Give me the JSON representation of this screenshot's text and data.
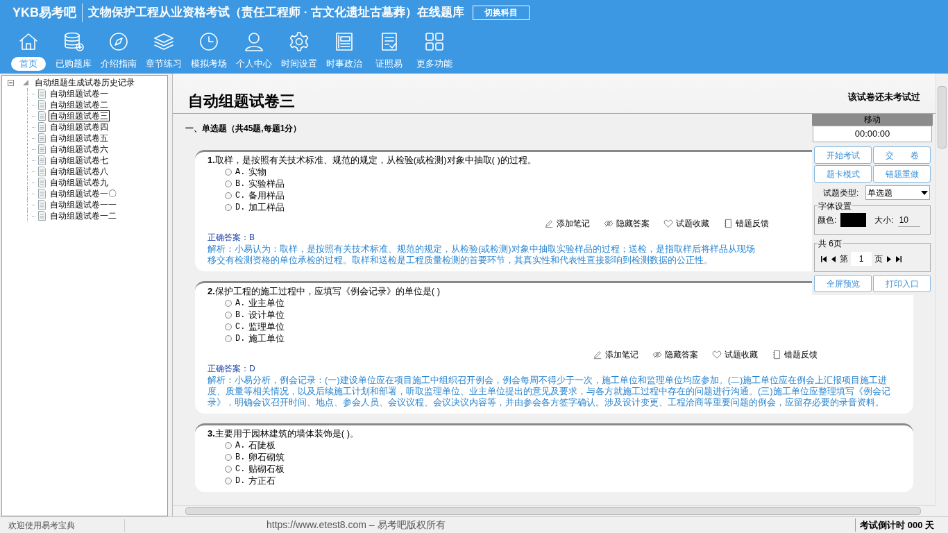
{
  "header": {
    "logo": "YKB易考吧",
    "title": "文物保护工程从业资格考试（责任工程师 · 古文化遗址古墓葬）在线题库",
    "switch_button": "切换科目"
  },
  "nav": [
    {
      "label": "首页",
      "selected": true
    },
    {
      "label": "已购题库",
      "selected": false
    },
    {
      "label": "介绍指南",
      "selected": false
    },
    {
      "label": "章节练习",
      "selected": false
    },
    {
      "label": "模拟考场",
      "selected": false
    },
    {
      "label": "个人中心",
      "selected": false
    },
    {
      "label": "时间设置",
      "selected": false
    },
    {
      "label": "时事政治",
      "selected": false
    },
    {
      "label": "证照易",
      "selected": false
    },
    {
      "label": "更多功能",
      "selected": false
    }
  ],
  "tree": {
    "label": "自动组题生成试卷历史记录",
    "expanded": true,
    "children": [
      {
        "label": "自动组题试卷一",
        "selected": false
      },
      {
        "label": "自动组题试卷二",
        "selected": false
      },
      {
        "label": "自动组题试卷三",
        "selected": true
      },
      {
        "label": "自动组题试卷四",
        "selected": false
      },
      {
        "label": "自动组题试卷五",
        "selected": false
      },
      {
        "label": "自动组题试卷六",
        "selected": false
      },
      {
        "label": "自动组题试卷七",
        "selected": false
      },
      {
        "label": "自动组题试卷八",
        "selected": false
      },
      {
        "label": "自动组题试卷九",
        "selected": false
      },
      {
        "label": "自动组题试卷一〇",
        "selected": false
      },
      {
        "label": "自动组题试卷一一",
        "selected": false
      },
      {
        "label": "自动组题试卷一二",
        "selected": false
      }
    ]
  },
  "exam": {
    "title": "自动组题试卷三",
    "status": "该试卷还未考试过",
    "section": "一、单选题（共45题,每题1分）",
    "questions": [
      {
        "number": "1.",
        "text": "取样，是按照有关技术标准、规范的规定，从检验(或检测)对象中抽取( )的过程。",
        "options": [
          {
            "letter": "A.",
            "text": "实物",
            "selected": false
          },
          {
            "letter": "B.",
            "text": "实验样品",
            "selected": false
          },
          {
            "letter": "C.",
            "text": "备用样品",
            "selected": false
          },
          {
            "letter": "D.",
            "text": "加工样品",
            "selected": false
          }
        ],
        "actions": [
          "添加笔记",
          "隐藏答案",
          "试题收藏",
          "错题反馈"
        ],
        "answer": "正确答案：B",
        "explanation": "解析：小易认为：取样，是按照有关技术标准、规范的规定，从检验(或检测)对象中抽取实验样品的过程；送检，是指取样后将样品从现场移交有检测资格的单位承检的过程。取样和送检是工程质量检测的首要环节，其真实性和代表性直接影响到检测数据的公正性。"
      },
      {
        "number": "2.",
        "text": "保护工程的施工过程中，应填写《例会记录》的单位是( )",
        "options": [
          {
            "letter": "A.",
            "text": "业主单位",
            "selected": false
          },
          {
            "letter": "B.",
            "text": "设计单位",
            "selected": false
          },
          {
            "letter": "C.",
            "text": "监理单位",
            "selected": false
          },
          {
            "letter": "D.",
            "text": "施工单位",
            "selected": false
          }
        ],
        "actions": [
          "添加笔记",
          "隐藏答案",
          "试题收藏",
          "错题反馈"
        ],
        "answer": "正确答案：D",
        "explanation": "解析：小易分析，例会记录：(一)建设单位应在项目施工中组织召开例会，例会每周不得少于一次，施工单位和监理单位均应参加。(二)施工单位应在例会上汇报项目施工进度、质量等相关情况，以及后续施工计划和部署，听取监理单位、业主单位提出的意见及要求，与各方就施工过程中存在的问题进行沟通。(三)施工单位应整理填写《例会记录》，明确会议召开时间、地点、参会人员、会议议程、会议决议内容等，并由参会各方签字确认。涉及设计变更、工程洽商等重要问题的例会，应留存必要的录音资料。"
      },
      {
        "number": "3.",
        "text": "主要用于园林建筑的墙体装饰是( )。",
        "options": [
          {
            "letter": "A.",
            "text": "石陡板",
            "selected": false
          },
          {
            "letter": "B.",
            "text": "卵石砌筑",
            "selected": false
          },
          {
            "letter": "C.",
            "text": "贴砌石板",
            "selected": false
          },
          {
            "letter": "D.",
            "text": "方正石",
            "selected": false
          }
        ]
      }
    ]
  },
  "panel": {
    "move_label": "移动",
    "timer": "00:00:00",
    "buttons": [
      "开始考试",
      "交　　卷",
      "题卡模式",
      "错题重做"
    ],
    "type_label": "试题类型:",
    "type_value": "单选题",
    "font_group": "字体设置",
    "color_label": "颜色:",
    "color": "#000000",
    "size_label": "大小:",
    "size_value": "10",
    "pages_group": "共 6页",
    "page_prefix": "第",
    "page_value": "1",
    "page_suffix": "页",
    "bottom_buttons": [
      "全屏预览",
      "打印入口"
    ]
  },
  "status_bar": {
    "welcome": "欢迎使用易考宝典",
    "copyright": "https://www.etest8.com – 易考吧版权所有",
    "countdown": "考试倒计时 000 天"
  }
}
